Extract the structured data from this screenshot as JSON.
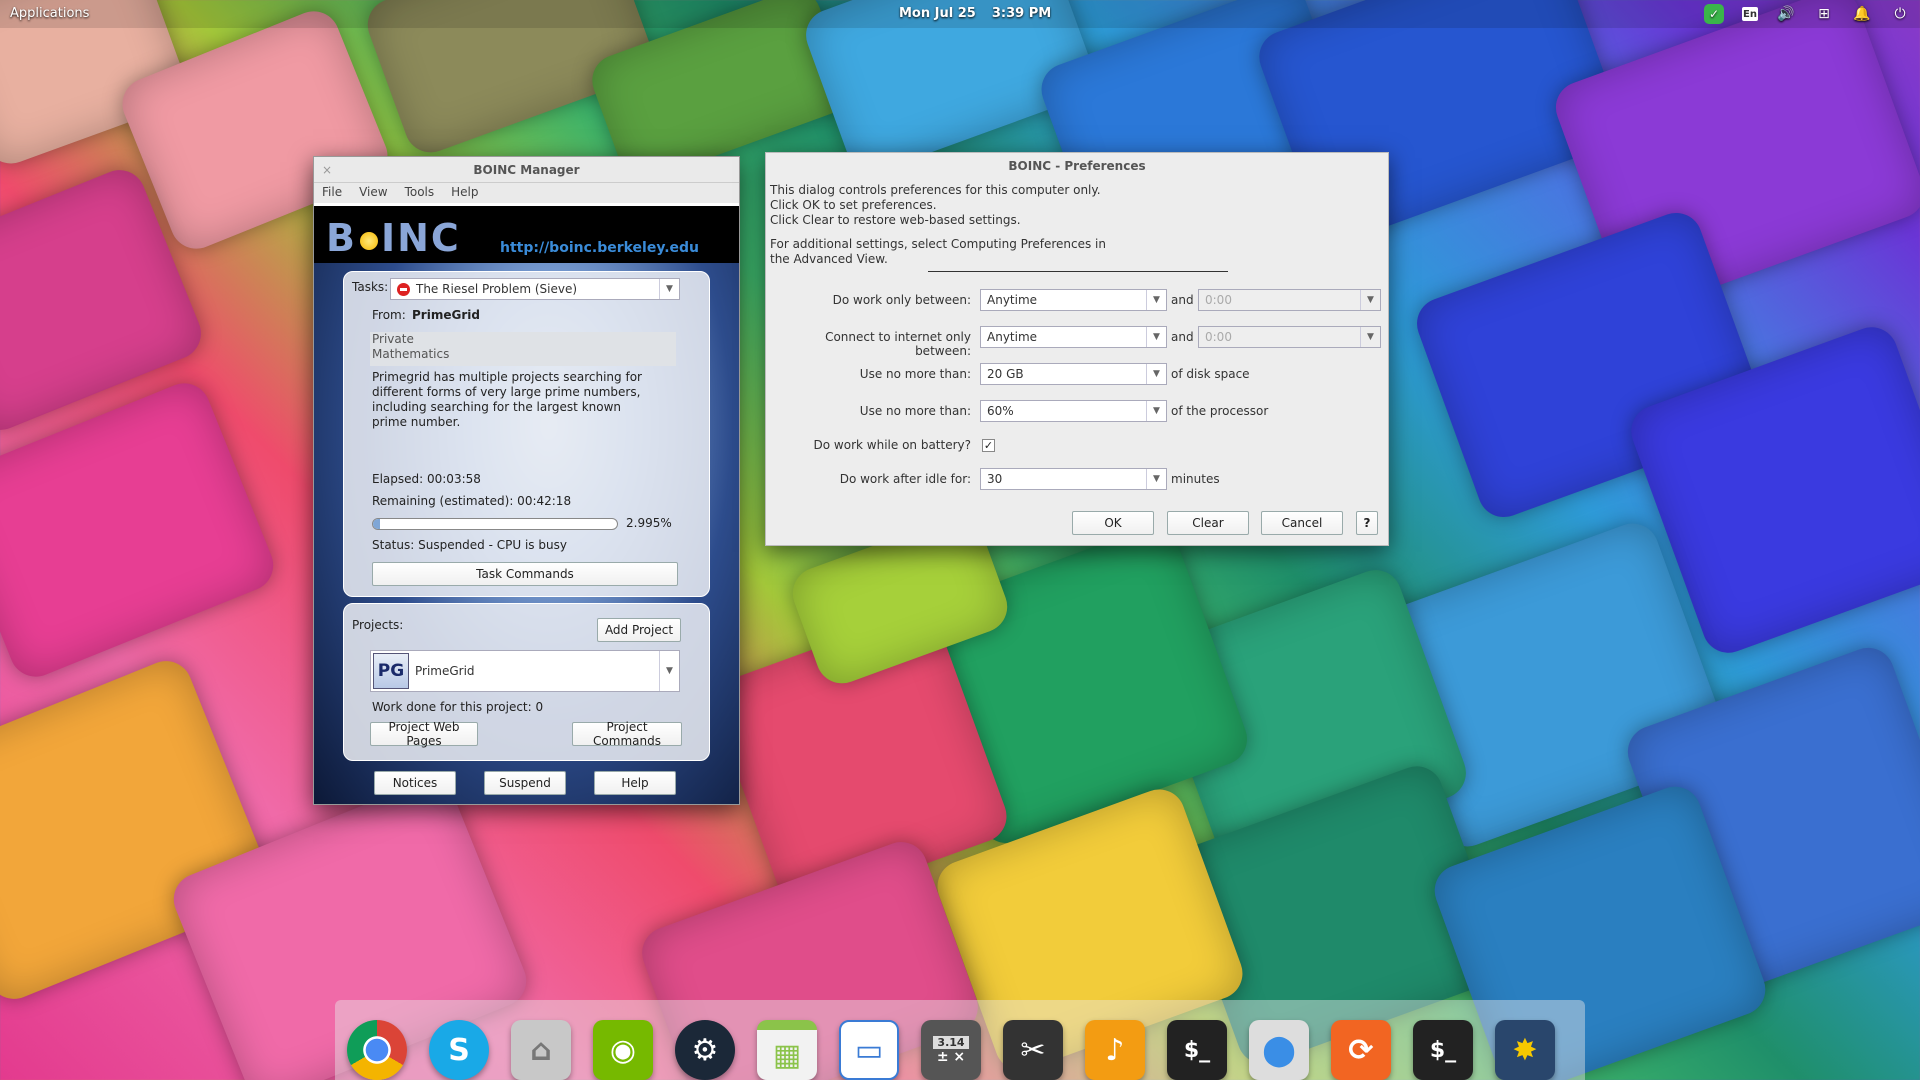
{
  "top_panel": {
    "applications_label": "Applications",
    "date": "Mon Jul 25",
    "time": "3:39 PM",
    "keyboard_layout": "En"
  },
  "boinc_manager": {
    "title": "BOINC Manager",
    "menu": [
      "File",
      "View",
      "Tools",
      "Help"
    ],
    "banner_logo": "B INC",
    "banner_url": "http://boinc.berkeley.edu",
    "tasks_label": "Tasks:",
    "task_selected": "The Riesel Problem (Sieve)",
    "from_label": "From:",
    "from_value": "PrimeGrid",
    "category_1": "Private",
    "category_2": "Mathematics",
    "description": "Primegrid has multiple projects searching for different forms of very large prime numbers, including searching for the largest known prime number.",
    "elapsed": "Elapsed: 00:03:58",
    "remaining": "Remaining (estimated): 00:42:18",
    "progress_percent": 2.995,
    "progress_text": "2.995%",
    "status": "Status: Suspended - CPU is busy",
    "task_commands_label": "Task Commands",
    "projects_label": "Projects:",
    "add_project_label": "Add Project",
    "project_logo_text": "PG",
    "project_selected": "PrimeGrid",
    "work_done": "Work done for this project: 0",
    "project_web_pages_label": "Project Web Pages",
    "project_commands_label": "Project Commands",
    "notices_label": "Notices",
    "suspend_label": "Suspend",
    "help_label": "Help"
  },
  "preferences": {
    "title": "BOINC - Preferences",
    "intro_1": "This dialog controls preferences for this computer only.",
    "intro_2": "Click OK to set preferences.",
    "intro_3": "Click Clear to restore web-based settings.",
    "intro_4": "For additional settings, select Computing Preferences in",
    "intro_5": "the Advanced View.",
    "work_between_label": "Do work only between:",
    "work_between_value": "Anytime",
    "work_and_label": "and",
    "work_and_value": "0:00",
    "net_between_label": "Connect to internet only between:",
    "net_between_value": "Anytime",
    "net_and_label": "and",
    "net_and_value": "0:00",
    "disk_label": "Use no more than:",
    "disk_value": "20 GB",
    "disk_suffix": "of disk space",
    "cpu_label": "Use no more than:",
    "cpu_value": "60%",
    "cpu_suffix": "of the processor",
    "battery_label": "Do work while on battery?",
    "battery_checked": true,
    "battery_check_glyph": "✓",
    "idle_label": "Do work after idle for:",
    "idle_value": "30",
    "idle_suffix": "minutes",
    "ok_label": "OK",
    "clear_label": "Clear",
    "cancel_label": "Cancel",
    "help_label": "?"
  },
  "dock": {
    "icons": [
      "chrome-icon",
      "skype-icon",
      "files-icon",
      "nvidia-icon",
      "steam-icon",
      "spreadsheet-icon",
      "image-viewer-icon",
      "calculator-icon",
      "screenshot-icon",
      "music-icon",
      "terminal-icon",
      "switchboard-icon",
      "update-icon",
      "terminal-icon",
      "boinc-icon"
    ],
    "calc_badge": "3.14"
  }
}
